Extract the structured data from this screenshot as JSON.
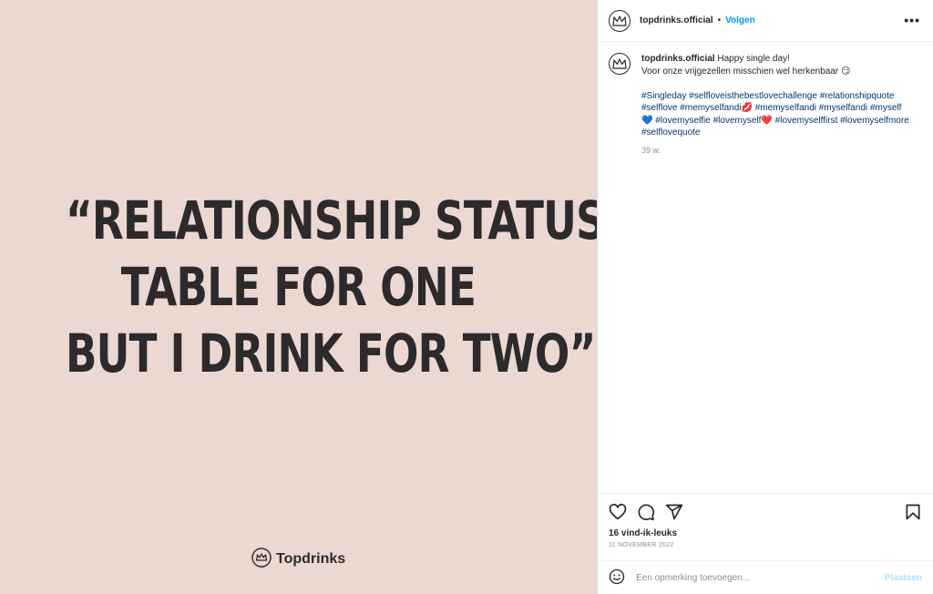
{
  "media": {
    "quote_lines": [
      "“RELATIONSHIP STATUS:",
      "TABLE FOR ONE",
      "BUT I DRINK FOR TWO”"
    ],
    "brand_name": "Topdrinks",
    "background_color": "#ead8d1",
    "text_color": "#2c2a2a"
  },
  "header": {
    "username": "topdrinks.official",
    "separator": "•",
    "follow_label": "Volgen",
    "more_label": "•••"
  },
  "caption": {
    "username": "topdrinks.official",
    "line1": "Happy single day!",
    "line2": "Voor onze vrijgezellen misschien wel herkenbaar",
    "line2_emoji": "😏",
    "hashtags": [
      "#Singleday",
      "#selfloveisthebestlovechallenge",
      "#relationshipquote",
      "#selflove",
      "#memyselfandi",
      "#memyselfandi",
      "#myselfandi",
      "#myself",
      "#lovemyselfie",
      "#lovemyself",
      "#lovemyselffirst",
      "#lovemyselfmore",
      "#selflovequote"
    ],
    "time": "39 w."
  },
  "actions": {
    "icons": [
      "heart-icon",
      "comment-icon",
      "share-icon",
      "bookmark-icon"
    ],
    "likes": "16 vind-ik-leuks",
    "date": "11 NOVEMBER 2022"
  },
  "comment": {
    "placeholder": "Een opmerking toevoegen...",
    "post_label": "Plaatsen"
  },
  "colors": {
    "accent": "#0095f6",
    "hashtag": "#00376b",
    "muted": "#8e8e8e"
  }
}
